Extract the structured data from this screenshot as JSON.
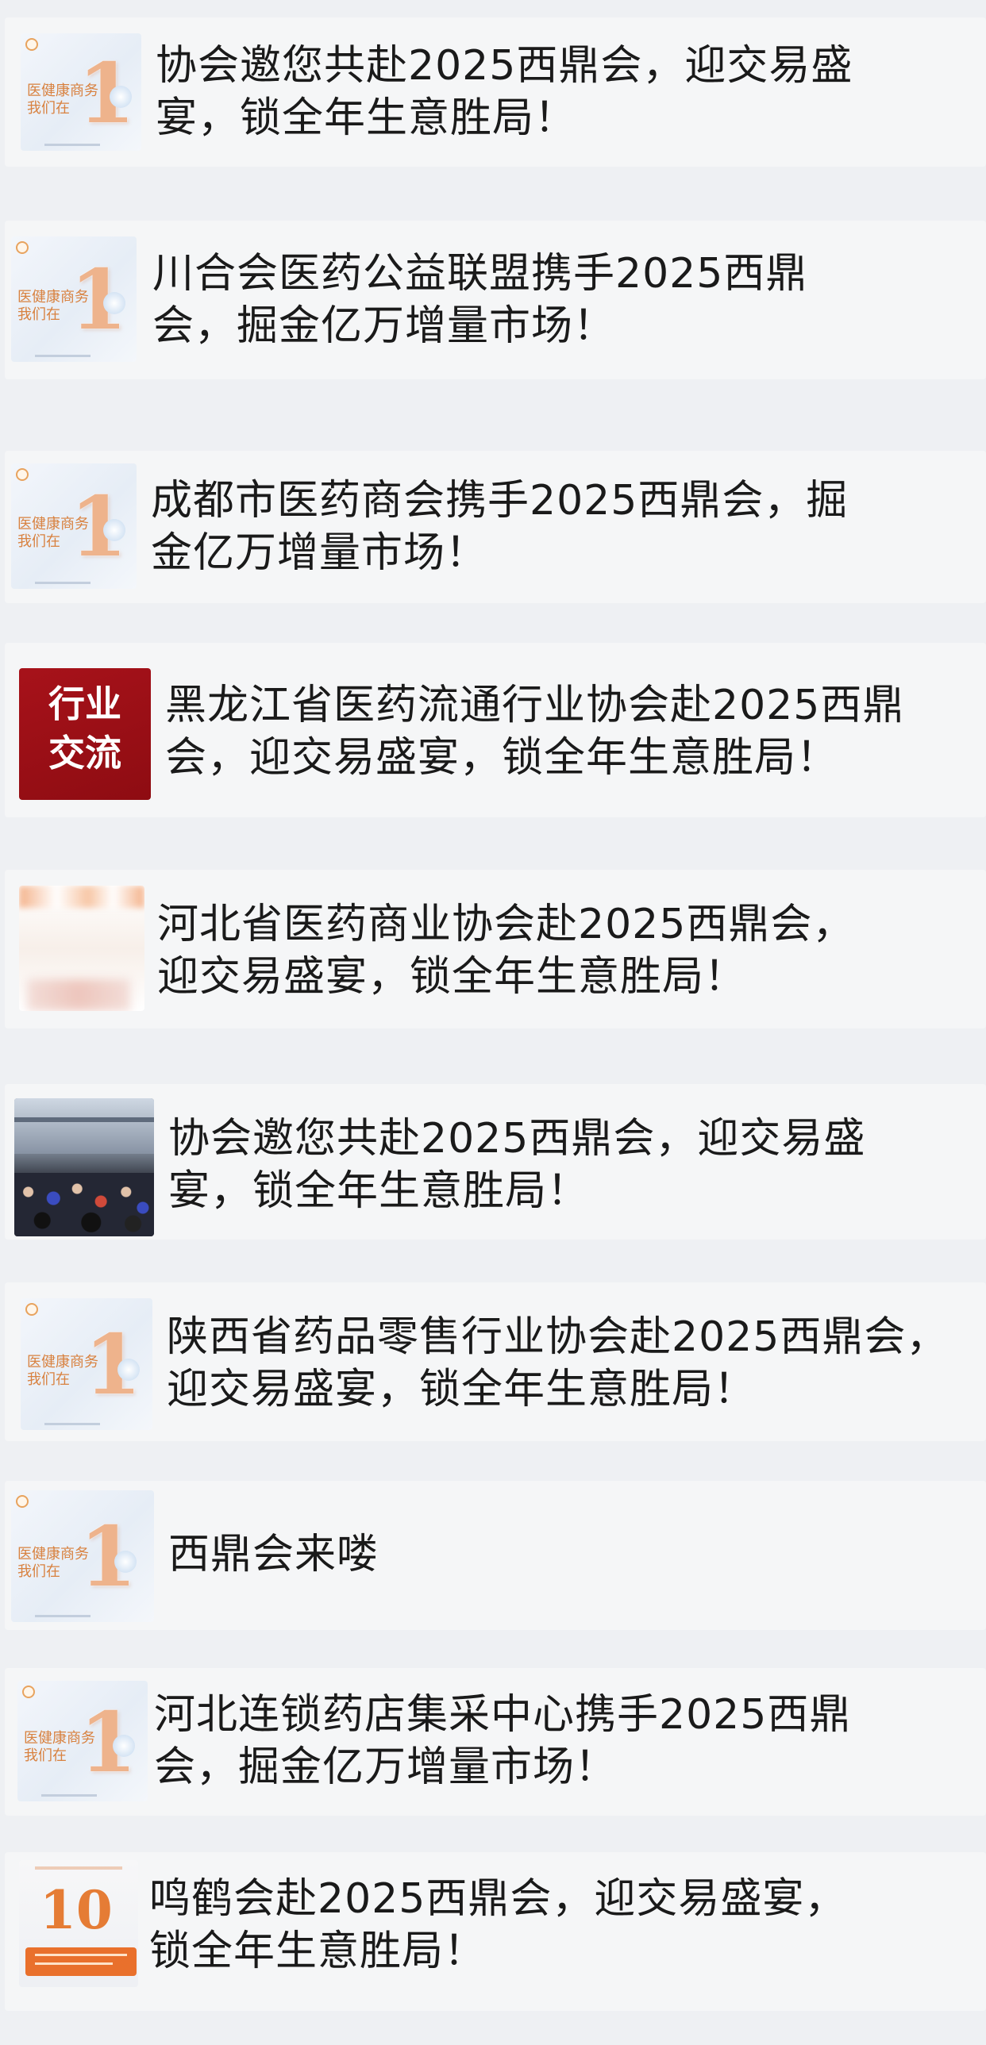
{
  "articles": [
    {
      "title": "协会邀您共赴2025西鼎会，迎交易盛宴，锁全年生意胜局！",
      "thumb": "event-poster-thumbnail"
    },
    {
      "title": "川合会医药公益联盟携手2025西鼎会，掘金亿万增量市场！",
      "thumb": "event-poster-thumbnail"
    },
    {
      "title": "成都市医药商会携手2025西鼎会，掘金亿万增量市场！",
      "thumb": "event-poster-thumbnail"
    },
    {
      "title": "黑龙江省医药流通行业协会赴2025西鼎会，迎交易盛宴，锁全年生意胜局！",
      "thumb": "industry-exchange-tag",
      "tag_lines": [
        "行业",
        "交流"
      ]
    },
    {
      "title": "河北省医药商业协会赴2025西鼎会，迎交易盛宴，锁全年生意胜局！",
      "thumb": "blurred-brand-thumbnail"
    },
    {
      "title": "协会邀您共赴2025西鼎会，迎交易盛宴，锁全年生意胜局！",
      "thumb": "exhibition-crowd-photo"
    },
    {
      "title": "陕西省药品零售行业协会赴2025西鼎会，迎交易盛宴，锁全年生意胜局！",
      "thumb": "event-poster-thumbnail"
    },
    {
      "title": "西鼎会来喽",
      "thumb": "event-poster-thumbnail"
    },
    {
      "title": "河北连锁药店集采中心携手2025西鼎会，掘金亿万增量市场！",
      "thumb": "event-poster-thumbnail"
    },
    {
      "title": "鸣鹤会赴2025西鼎会，迎交易盛宴，锁全年生意胜局！",
      "thumb": "anniversary-logo-thumbnail"
    }
  ],
  "colors": {
    "page_bg": "#eef0f3",
    "card_bg": "#f5f6f7",
    "title_text": "#1a1a1a",
    "tag_red": "#a7121a",
    "accent_orange": "#e9702c"
  }
}
